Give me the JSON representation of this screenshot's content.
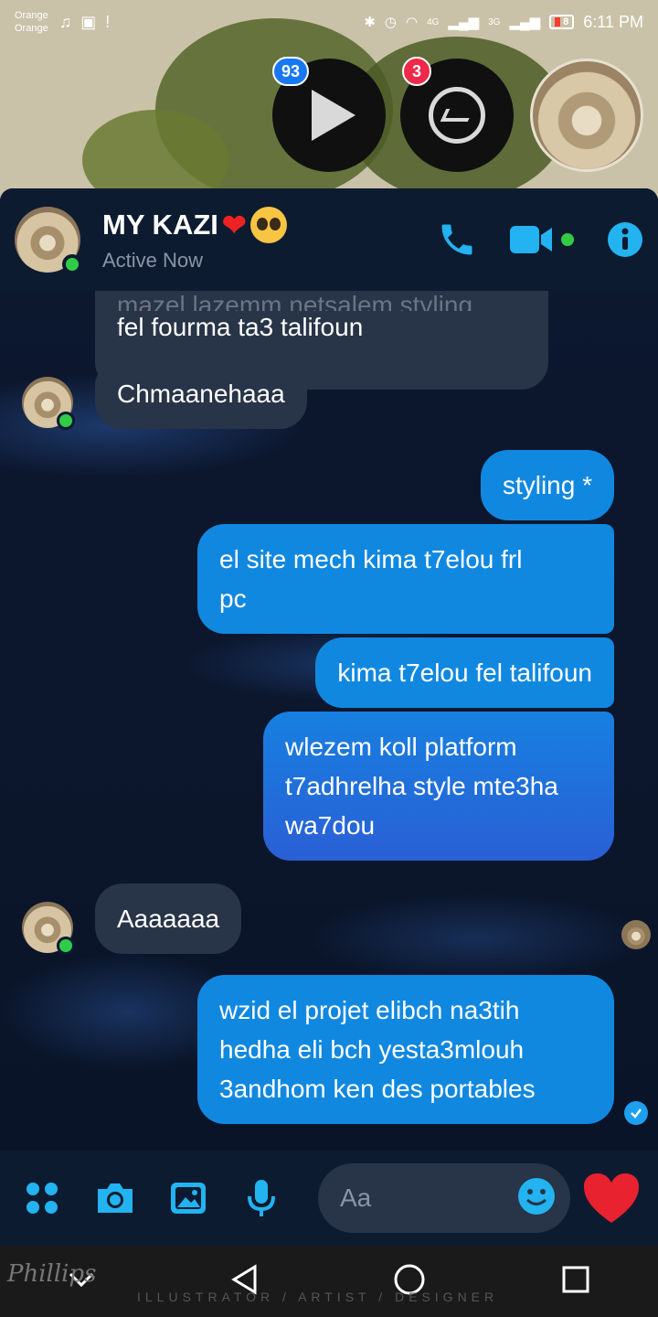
{
  "status_bar": {
    "carrier_1": "Orange",
    "carrier_2": "Orange",
    "network_4g": "4G",
    "network_3g": "3G",
    "battery": "8",
    "time": "6:11 PM"
  },
  "chat_heads": {
    "video_badge": "93",
    "messenger_badge": "3"
  },
  "header": {
    "contact_name": "MY KAZI",
    "status": "Active Now"
  },
  "messages": {
    "faded_top": "mazel lazemm netsalem styling",
    "m1": "fel fourma ta3 talifoun",
    "m2": "Chmaanehaaa",
    "m3": "styling *",
    "m4_line1": "el site mech kima t7elou frl",
    "m4_line2": "pc",
    "m5": "kima t7elou fel talifoun",
    "m6_line1": "wlezem koll platform",
    "m6_line2": "t7adhrelha style mte3ha",
    "m6_line3": "wa7dou",
    "m7": "Aaaaaaa",
    "m8_line1": "wzid el projet elibch na3tih",
    "m8_line2": "hedha eli bch yesta3mlouh",
    "m8_line3": "3andhom ken des portables"
  },
  "composer": {
    "placeholder": "Aa"
  },
  "navbar": {
    "watermark": "ILLUSTRATOR / ARTIST / DESIGNER",
    "signature": "Phillips"
  },
  "colors": {
    "accent": "#22b3f0",
    "outgoing_bubble": "#1188e0",
    "incoming_bubble": "#283447",
    "online": "#31cc46"
  },
  "icons": [
    "music-note-icon",
    "pulse-icon",
    "alert-icon",
    "bluetooth-icon",
    "alarm-icon",
    "wifi-icon",
    "signal-icon",
    "play-icon",
    "messenger-icon",
    "phone-icon",
    "video-camera-icon",
    "info-icon",
    "apps-icon",
    "camera-icon",
    "gallery-icon",
    "microphone-icon",
    "smiley-icon",
    "heart-icon",
    "nav-down-icon",
    "nav-back-icon",
    "nav-home-icon",
    "nav-recents-icon"
  ]
}
